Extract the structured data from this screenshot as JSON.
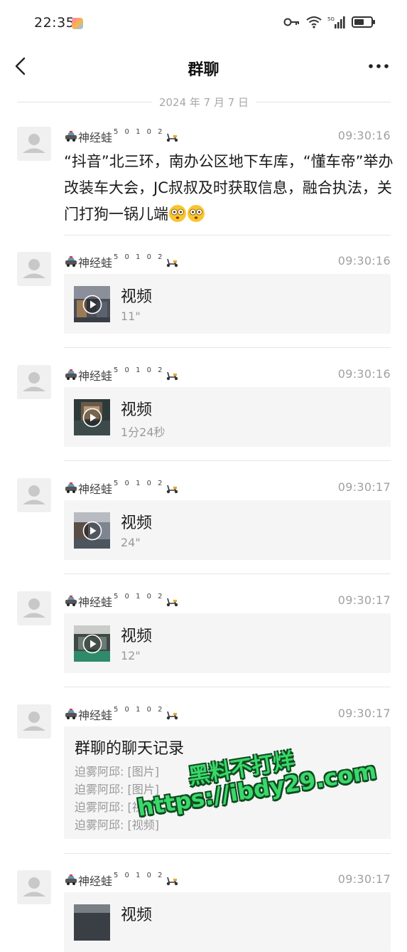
{
  "status_bar": {
    "time": "22:35",
    "network": "5G"
  },
  "header": {
    "title": "群聊"
  },
  "date_divider": "2024 年 7 月 7 日",
  "sender": {
    "name": "神经蛙",
    "superscript": "5 0 1 0 2"
  },
  "messages": [
    {
      "time": "09:30:16",
      "type": "text",
      "text": "“抖音”北三环，南办公区地下车库，“懂车帝”举办改装车大会，JC叔叔及时获取信息，融合执法，关门打狗一锅儿端"
    },
    {
      "time": "09:30:16",
      "type": "video",
      "title": "视频",
      "duration": "11\""
    },
    {
      "time": "09:30:16",
      "type": "video",
      "title": "视频",
      "duration": "1分24秒"
    },
    {
      "time": "09:30:17",
      "type": "video",
      "title": "视频",
      "duration": "24\""
    },
    {
      "time": "09:30:17",
      "type": "video",
      "title": "视频",
      "duration": "12\""
    },
    {
      "time": "09:30:17",
      "type": "record",
      "title": "群聊的聊天记录",
      "lines": [
        "迫雾阿邱: [图片]",
        "迫雾阿邱: [图片]",
        "迫雾阿邱: [视频]",
        "迫雾阿邱: [视频]"
      ]
    },
    {
      "time": "09:30:17",
      "type": "video",
      "title": "视频"
    }
  ],
  "watermark": {
    "line1": "黑料不打烊",
    "line2": "https://ibdy29.com"
  },
  "colors": {
    "watermark_fill": "#3ad86a",
    "watermark_outline": "#0d4a1f",
    "card_bg": "#f5f5f5",
    "time_gray": "#a0a0a0"
  }
}
